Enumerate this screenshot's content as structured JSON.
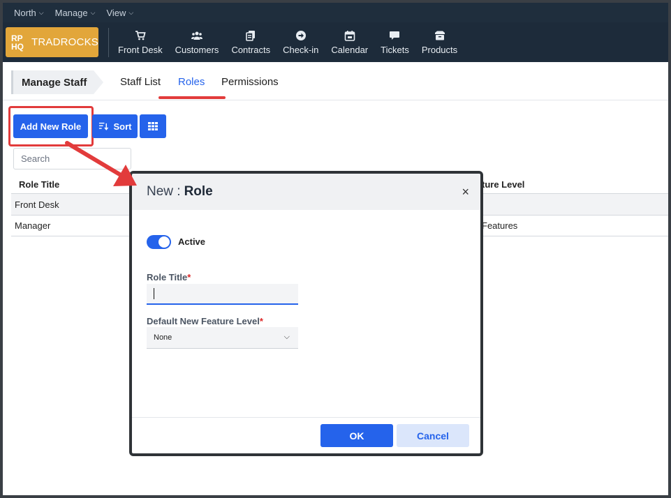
{
  "menubar": {
    "items": [
      {
        "label": "North"
      },
      {
        "label": "Manage"
      },
      {
        "label": "View"
      }
    ]
  },
  "brand": {
    "mark_line1": "RP",
    "mark_line2": "HQ",
    "name": "TRADROCKS"
  },
  "nav": {
    "items": [
      {
        "label": "Front Desk",
        "icon": "cart-icon"
      },
      {
        "label": "Customers",
        "icon": "users-icon"
      },
      {
        "label": "Contracts",
        "icon": "contracts-icon"
      },
      {
        "label": "Check-in",
        "icon": "arrow-circle-icon"
      },
      {
        "label": "Calendar",
        "icon": "calendar-icon"
      },
      {
        "label": "Tickets",
        "icon": "chat-icon"
      },
      {
        "label": "Products",
        "icon": "box-icon"
      }
    ]
  },
  "subheader": {
    "breadcrumb": "Manage Staff",
    "tabs": [
      {
        "label": "Staff List",
        "active": false
      },
      {
        "label": "Roles",
        "active": true
      },
      {
        "label": "Permissions",
        "active": false
      }
    ]
  },
  "toolbar": {
    "add_label": "Add New Role",
    "sort_label": "Sort",
    "search_placeholder": "Search"
  },
  "table": {
    "headers": {
      "title": "Role Title",
      "feature_level": "ture Level"
    },
    "rows": [
      {
        "title": "Front Desk",
        "feature_level": ""
      },
      {
        "title": "Manager",
        "feature_level": "Features"
      }
    ]
  },
  "modal": {
    "title_prefix": "New :",
    "title_entity": "Role",
    "close_glyph": "×",
    "active_label": "Active",
    "active_on": true,
    "role_title_label": "Role Title",
    "role_title_value": "",
    "feature_level_label": "Default New Feature Level",
    "feature_level_value": "None",
    "required_mark": "*",
    "ok_label": "OK",
    "cancel_label": "Cancel"
  },
  "colors": {
    "accent": "#2563eb",
    "highlight": "#e23b3b",
    "brand": "#e2a63a",
    "nav_bg": "#1d2b3a"
  }
}
